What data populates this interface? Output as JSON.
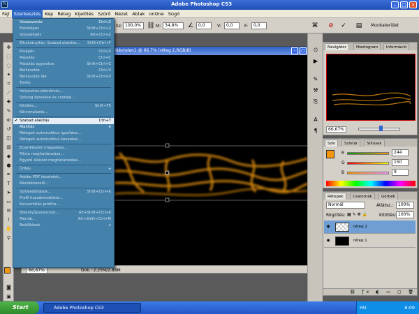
{
  "window": {
    "title": "Adobe Photoshop CS3",
    "app_icon": "Ps"
  },
  "menubar": [
    "Fájl",
    "Szerkesztés",
    "Kép",
    "Réteg",
    "Kijelölés",
    "Szűrő",
    "Nézet",
    "Ablak",
    "onOne",
    "Súgó"
  ],
  "options": {
    "sz_label": "Sz:",
    "sz_value": "100,0%",
    "m_label": "M:",
    "m_value": "34,8%",
    "angle_value": "0,0",
    "v_label": "V:",
    "v_value": "0,0",
    "f_label": "F:",
    "f_value": "0,0",
    "workspace": "Munkaterület"
  },
  "document": {
    "title": "Névtelen1 @ 66,7% (réteg 2,RGB/8)",
    "zoom": "66,67%",
    "doc_info": "Dok.: 2,25M/2,88M"
  },
  "edit_menu": [
    {
      "label": "Visszavonás",
      "shortcut": "Ctrl+Z",
      "enabled": true
    },
    {
      "label": "Előrelépés",
      "shortcut": "Shift+Ctrl+Z",
      "enabled": false
    },
    {
      "label": "Visszalépés",
      "shortcut": "Alt+Ctrl+Z",
      "enabled": false
    },
    {
      "sep": true
    },
    {
      "label": "Elhalványítás: Szabad alakítás...",
      "shortcut": "Shift+Ctrl+F",
      "enabled": false
    },
    {
      "sep": true
    },
    {
      "label": "Kivágás",
      "shortcut": "Ctrl+X",
      "enabled": false
    },
    {
      "label": "Másolás",
      "shortcut": "Ctrl+C",
      "enabled": false
    },
    {
      "label": "Másolás egyesítve",
      "shortcut": "Shift+Ctrl+C",
      "enabled": false
    },
    {
      "label": "Beillesztés",
      "shortcut": "Ctrl+V",
      "enabled": false
    },
    {
      "label": "Beillesztés ide",
      "shortcut": "Shift+Ctrl+V",
      "enabled": false
    },
    {
      "label": "Törlés",
      "shortcut": "",
      "enabled": false
    },
    {
      "sep": true
    },
    {
      "label": "Helyesírás-ellenőrzés...",
      "shortcut": "",
      "enabled": false
    },
    {
      "label": "Szöveg keresése és cseréje...",
      "shortcut": "",
      "enabled": false
    },
    {
      "sep": true
    },
    {
      "label": "Kitöltés...",
      "shortcut": "Shift+F5",
      "enabled": false
    },
    {
      "label": "Körvonalazás...",
      "shortcut": "",
      "enabled": false
    },
    {
      "sep": true
    },
    {
      "label": "Szabad alakítás",
      "shortcut": "Ctrl+T",
      "enabled": true,
      "checked": true,
      "highlight": true
    },
    {
      "label": "Alakítás",
      "shortcut": "",
      "enabled": true,
      "submenu": true
    },
    {
      "label": "Rétegek automatikus igazítása...",
      "shortcut": "",
      "enabled": false
    },
    {
      "label": "Rétegek automatikus keverése...",
      "shortcut": "",
      "enabled": false
    },
    {
      "sep": true
    },
    {
      "label": "Ecsetkészlet megadása...",
      "shortcut": "",
      "enabled": false
    },
    {
      "label": "Minta meghatározása...",
      "shortcut": "",
      "enabled": false
    },
    {
      "label": "Egyedi alakzat meghatározása...",
      "shortcut": "",
      "enabled": false
    },
    {
      "sep": true
    },
    {
      "label": "Ürítés",
      "shortcut": "",
      "enabled": false,
      "submenu": true
    },
    {
      "sep": true
    },
    {
      "label": "Adobe PDF készletek...",
      "shortcut": "",
      "enabled": false
    },
    {
      "label": "Készletkezelő...",
      "shortcut": "",
      "enabled": false
    },
    {
      "sep": true
    },
    {
      "label": "Színbeállítások...",
      "shortcut": "Shift+Ctrl+K",
      "enabled": false
    },
    {
      "label": "Profil hozzárendelése...",
      "shortcut": "",
      "enabled": false
    },
    {
      "label": "Konvertálás profilra...",
      "shortcut": "",
      "enabled": false
    },
    {
      "sep": true
    },
    {
      "label": "Billentyűparancsok...",
      "shortcut": "Alt+Shift+Ctrl+K",
      "enabled": false
    },
    {
      "label": "Menük...",
      "shortcut": "Alt+Shift+Ctrl+M",
      "enabled": false
    },
    {
      "label": "Beállítások",
      "shortcut": "",
      "enabled": false,
      "submenu": true
    }
  ],
  "navigator": {
    "tabs": [
      "Navigátor",
      "Hisztogram",
      "Információ"
    ],
    "zoom": "66,67%"
  },
  "color_panel": {
    "tabs": [
      "Szín",
      "Színtár",
      "Stílusok"
    ],
    "r_label": "R",
    "r": "244",
    "g_label": "G",
    "g": "150",
    "b_label": "B",
    "b": "9",
    "foreground": "#f49609"
  },
  "layers_panel": {
    "tabs": [
      "Rétegek",
      "Csatornák",
      "Görbék"
    ],
    "blend_mode": "Normál",
    "opacity_label": "Átlátsz.:",
    "opacity": "100%",
    "lock_label": "Rögzítés:",
    "fill_label": "Kitöltés:",
    "fill": "100%",
    "layers": [
      {
        "name": "réteg 2",
        "selected": true
      },
      {
        "name": "réteg 1",
        "selected": false
      }
    ]
  },
  "taskbar": {
    "start": "Start",
    "task": "Adobe Photoshop CS3",
    "lang": "HU",
    "clock": "6:09"
  },
  "colors": {
    "accent_orange": "#f49609",
    "menu_bg": "#4482ac",
    "selection": "#316ac5"
  }
}
